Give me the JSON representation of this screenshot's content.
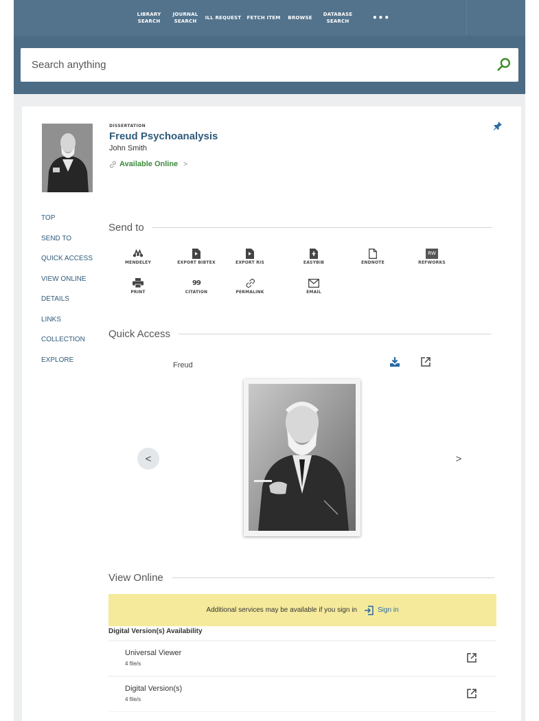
{
  "nav": {
    "items": [
      {
        "label": "LIBRARY\nSEARCH"
      },
      {
        "label": "JOURNAL\nSEARCH"
      },
      {
        "label": "ILL REQUEST"
      },
      {
        "label": "FETCH ITEM"
      },
      {
        "label": "BROWSE"
      },
      {
        "label": "DATABASE\nSEARCH"
      },
      {
        "label": "•••"
      }
    ]
  },
  "search": {
    "placeholder": "Search anything",
    "icon": "search-icon"
  },
  "record": {
    "type": "DISSERTATION",
    "title": "Freud Psychoanalysis",
    "author": "John Smith",
    "availability": "Available Online",
    "availability_chevron": ">"
  },
  "sidenav": [
    "TOP",
    "SEND TO",
    "QUICK ACCESS",
    "VIEW ONLINE",
    "DETAILS",
    "LINKS",
    "COLLECTION",
    "EXPLORE"
  ],
  "send_to": {
    "heading": "Send to",
    "actions": [
      {
        "label": "MENDELEY",
        "icon": "mendeley-icon"
      },
      {
        "label": "EXPORT BIBTEX",
        "icon": "bibtex-file-icon"
      },
      {
        "label": "EXPORT RIS",
        "icon": "ris-file-icon"
      },
      {
        "label": "EASYBIB",
        "icon": "easybib-file-icon"
      },
      {
        "label": "ENDNOTE",
        "icon": "endnote-file-icon"
      },
      {
        "label": "REFWORKS",
        "icon": "refworks-icon",
        "icon_text": "RW"
      },
      {
        "label": "PRINT",
        "icon": "printer-icon"
      },
      {
        "label": "CITATION",
        "icon": "quote-icon",
        "icon_text": "99"
      },
      {
        "label": "PERMALINK",
        "icon": "link-icon"
      },
      {
        "label": "EMAIL",
        "icon": "envelope-icon"
      }
    ]
  },
  "quick_access": {
    "heading": "Quick Access",
    "caption": "Freud",
    "prev": "<",
    "next": ">"
  },
  "view_online": {
    "heading": "View Online",
    "notice": "Additional services may be available if you sign in",
    "sign_in": "Sign in",
    "availability_heading": "Digital Version(s) Availability",
    "rows": [
      {
        "name": "Universal Viewer",
        "count": "4 file/s"
      },
      {
        "name": "Digital Version(s)",
        "count": "4 file/s"
      }
    ]
  },
  "colors": {
    "nav_bg": "#53738c",
    "search_band": "#4c6b84",
    "link": "#2e5a7a",
    "available": "#3b8a3b",
    "notice_bg": "#f5ea9c",
    "pin": "#2e6b9e"
  }
}
